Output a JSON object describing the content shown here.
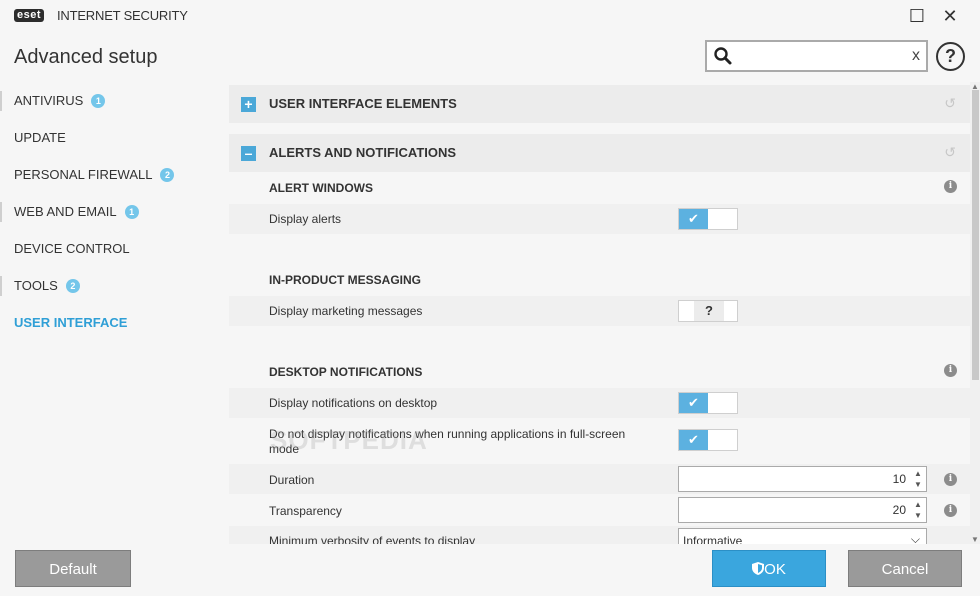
{
  "app": {
    "logo": "eset",
    "product": "INTERNET SECURITY",
    "window_buttons": {
      "maximize": "☐",
      "close": "✕"
    }
  },
  "header": {
    "title": "Advanced setup",
    "search": {
      "value": "",
      "placeholder": "",
      "clear": "x"
    },
    "help": "?"
  },
  "sidebar": {
    "items": [
      {
        "label": "ANTIVIRUS",
        "badge": "1"
      },
      {
        "label": "UPDATE",
        "badge": ""
      },
      {
        "label": "PERSONAL FIREWALL",
        "badge": "2"
      },
      {
        "label": "WEB AND EMAIL",
        "badge": "1"
      },
      {
        "label": "DEVICE CONTROL",
        "badge": ""
      },
      {
        "label": "TOOLS",
        "badge": "2"
      },
      {
        "label": "USER INTERFACE",
        "badge": ""
      }
    ]
  },
  "sections": [
    {
      "toggle": "+",
      "title": "USER INTERFACE ELEMENTS"
    },
    {
      "toggle": "–",
      "title": "ALERTS AND NOTIFICATIONS"
    }
  ],
  "groups": {
    "alert_windows": {
      "title": "ALERT WINDOWS",
      "display_alerts": {
        "label": "Display alerts",
        "state": "✔"
      }
    },
    "in_product": {
      "title": "IN-PRODUCT MESSAGING",
      "marketing": {
        "label": "Display marketing messages",
        "state": "?"
      }
    },
    "desktop": {
      "title": "DESKTOP NOTIFICATIONS",
      "display_notifications": {
        "label": "Display notifications on desktop",
        "state": "✔"
      },
      "fullscreen": {
        "label": "Do not display notifications when running applications in full-screen mode",
        "state": "✔"
      },
      "duration": {
        "label": "Duration",
        "value": "10"
      },
      "transparency": {
        "label": "Transparency",
        "value": "20"
      },
      "verbosity": {
        "label": "Minimum verbosity of events to display",
        "value": "Informative"
      }
    }
  },
  "footer": {
    "default": "Default",
    "ok": "OK",
    "cancel": "Cancel"
  },
  "watermark": "SOFTPEDIA",
  "colors": {
    "accent": "#3aa6de",
    "active_nav": "#2f9fd6",
    "badge": "#74c6ea",
    "grey_button": "#9a9a9a"
  }
}
